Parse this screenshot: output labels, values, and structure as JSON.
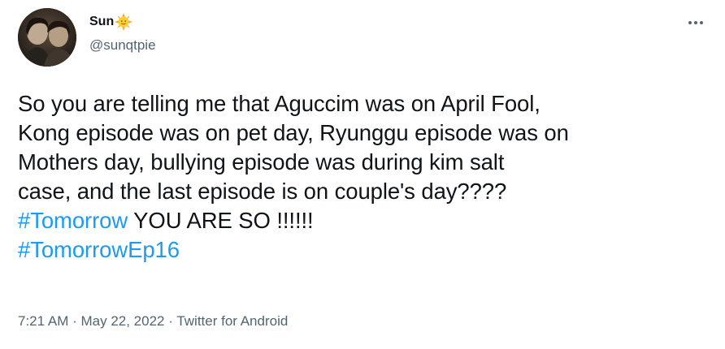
{
  "author": {
    "display_name": "Sun",
    "handle": "@sunqtpie",
    "name_emoji": "sun-with-face-emoji"
  },
  "tweet": {
    "lines": [
      "So you are telling me that Aguccim was on April Fool,",
      "Kong episode was on pet day, Ryunggu episode was on",
      "Mothers day, bullying episode was during kim salt",
      "case, and the last episode is on couple's day????"
    ],
    "hashtag_1": "#Tomorrow",
    "after_hashtag_1": " YOU ARE SO !!!!!!",
    "hashtag_2": "#TomorrowEp16"
  },
  "meta": {
    "time": "7:21 AM",
    "separator": " · ",
    "date": "May 22, 2022",
    "source": "Twitter for Android"
  },
  "colors": {
    "text": "#0f1419",
    "secondary": "#536471",
    "link": "#1d9bf0"
  },
  "icons": {
    "more": "more-horizontal-icon"
  }
}
